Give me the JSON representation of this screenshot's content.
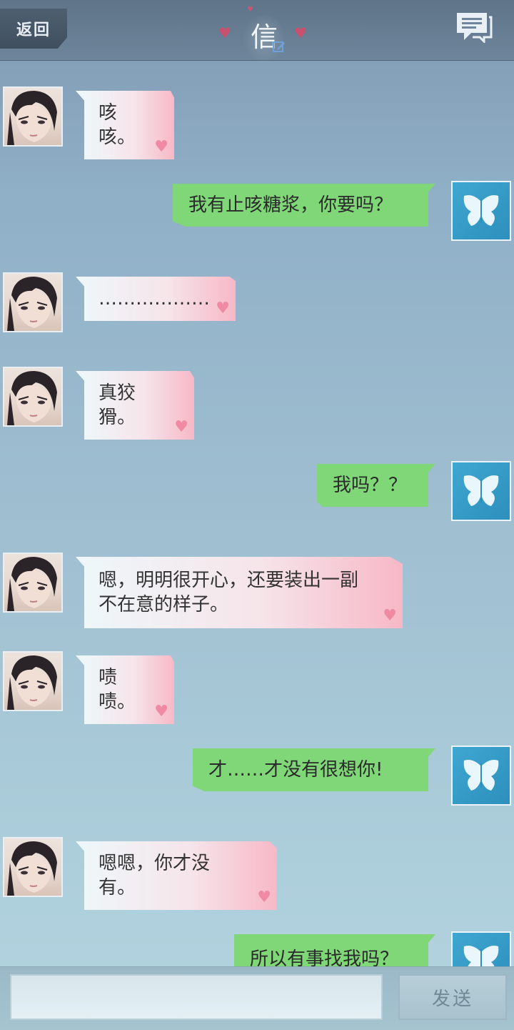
{
  "header": {
    "back_label": "返回",
    "title": "信"
  },
  "messages": [
    {
      "side": "left",
      "text": "咳咳。"
    },
    {
      "side": "right",
      "text": "我有止咳糖浆，你要吗？"
    },
    {
      "side": "left",
      "text": "………………"
    },
    {
      "side": "left",
      "text": "真狡猾。"
    },
    {
      "side": "right",
      "text": "我吗？？"
    },
    {
      "side": "left",
      "text": "嗯，明明很开心，还要装出一副不在意的样子。"
    },
    {
      "side": "left",
      "text": "啧啧。"
    },
    {
      "side": "right",
      "text": "才……才没有很想你!"
    },
    {
      "side": "left",
      "text": "嗯嗯，你才没有。"
    },
    {
      "side": "right",
      "text": "所以有事找我吗？"
    }
  ],
  "composer": {
    "input_value": "",
    "send_label": "发送"
  },
  "colors": {
    "outgoing_bubble": "#7fd778",
    "incoming_bubble_accent": "#f7b8c6",
    "avatar_right_bg": "#2d8fbd"
  },
  "icons": {
    "header_menu": "chat-bubbles-icon",
    "title_edit": "edit-pencil-icon",
    "right_avatar": "butterfly-icon"
  }
}
